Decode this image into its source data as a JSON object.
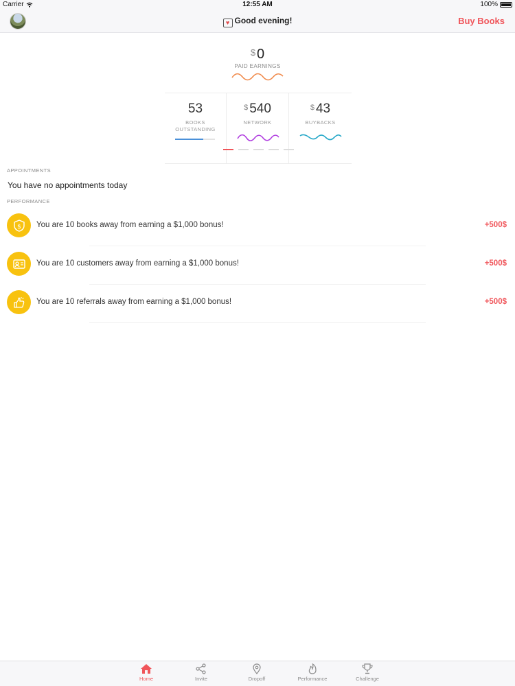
{
  "status_bar": {
    "carrier": "Carrier",
    "time": "12:55 AM",
    "battery": "100%"
  },
  "nav": {
    "greeting": "Good evening!",
    "buy_books": "Buy Books"
  },
  "earnings": {
    "currency": "$",
    "paid_value": "0",
    "paid_label": "PAID EARNINGS",
    "stats": [
      {
        "value": "53",
        "currency": "",
        "label_line1": "BOOKS",
        "label_line2": "OUTSTANDING",
        "progress": 0.7,
        "color": "#4a90d9"
      },
      {
        "value": "540",
        "currency": "$",
        "label_line1": "NETWORK",
        "label_line2": "",
        "color": "#b13ee0"
      },
      {
        "value": "43",
        "currency": "$",
        "label_line1": "BUYBACKS",
        "label_line2": "",
        "color": "#29a9c9"
      }
    ],
    "pager": {
      "count": 5,
      "active_index": 0
    }
  },
  "appointments": {
    "header": "APPOINTMENTS",
    "empty_text": "You have no appointments today"
  },
  "performance": {
    "header": "PERFORMANCE",
    "items": [
      {
        "icon": "dollar-shield-icon",
        "text": "You are 10 books away from earning a $1,000 bonus!",
        "bonus": "+500$"
      },
      {
        "icon": "id-card-icon",
        "text": "You are 10 customers away from earning a $1,000 bonus!",
        "bonus": "+500$"
      },
      {
        "icon": "thumbs-up-icon",
        "text": "You are 10 referrals away from earning a $1,000 bonus!",
        "bonus": "+500$"
      }
    ]
  },
  "tabs": [
    {
      "label": "Home",
      "icon": "home-icon",
      "active": true
    },
    {
      "label": "Invite",
      "icon": "share-icon",
      "active": false
    },
    {
      "label": "Dropoff",
      "icon": "location-pin-icon",
      "active": false
    },
    {
      "label": "Performance",
      "icon": "flame-icon",
      "active": false
    },
    {
      "label": "Challenge",
      "icon": "trophy-icon",
      "active": false
    }
  ],
  "colors": {
    "accent": "#f0555a",
    "badge_yellow": "#f8c20f",
    "paid_wave": "#f08a4b"
  }
}
